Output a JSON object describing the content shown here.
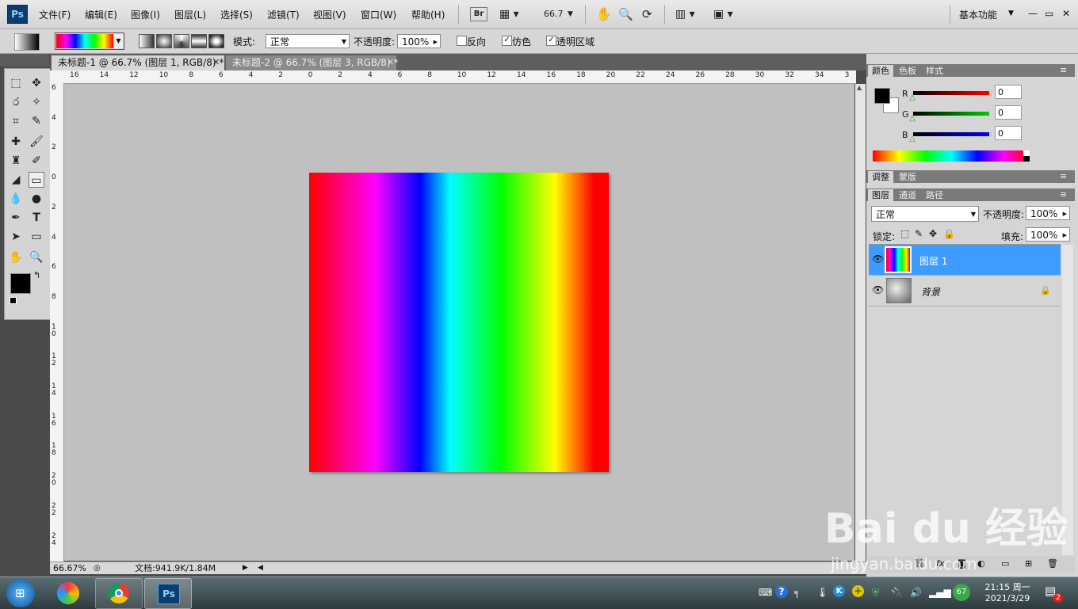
{
  "app": {
    "logo_text": "Ps"
  },
  "menubar": {
    "items": [
      "文件(F)",
      "编辑(E)",
      "图像(I)",
      "图层(L)",
      "选择(S)",
      "滤镜(T)",
      "视图(V)",
      "窗口(W)",
      "帮助(H)"
    ],
    "bridge_label": "Br",
    "zoom_value": "66.7",
    "workspace_label": "基本功能",
    "window_controls": [
      "—",
      "▭",
      "✕"
    ]
  },
  "options": {
    "mode_label": "模式:",
    "mode_value": "正常",
    "opacity_label": "不透明度:",
    "opacity_value": "100%",
    "reverse_label": "反向",
    "reverse_checked": false,
    "dither_label": "仿色",
    "dither_checked": true,
    "transparency_label": "透明区域",
    "transparency_checked": true
  },
  "tabs": [
    {
      "label": "未标题-1 @ 66.7% (图层 1, RGB/8) *",
      "active": true
    },
    {
      "label": "未标题-2 @ 66.7% (图层 3, RGB/8) *",
      "active": false
    }
  ],
  "ruler": {
    "top_labels": [
      "16",
      "14",
      "12",
      "10",
      "8",
      "6",
      "4",
      "2",
      "0",
      "2",
      "4",
      "6",
      "8",
      "10",
      "12",
      "14",
      "16",
      "18",
      "20",
      "22",
      "24",
      "26",
      "28",
      "30",
      "32",
      "34",
      "3"
    ],
    "left_labels": [
      "6",
      "4",
      "2",
      "0",
      "2",
      "4",
      "6",
      "8",
      "10",
      "12",
      "14",
      "16",
      "18",
      "20",
      "22",
      "24"
    ]
  },
  "status": {
    "zoom": "66.67%",
    "doc_info": "文档:941.9K/1.84M"
  },
  "color_panel": {
    "tabs": [
      "颜色",
      "色板",
      "样式"
    ],
    "channels": [
      {
        "name": "R",
        "value": "0",
        "color": "#c00000"
      },
      {
        "name": "G",
        "value": "0",
        "color": "#00a000"
      },
      {
        "name": "B",
        "value": "0",
        "color": "#0000c0"
      }
    ]
  },
  "adjust_panel": {
    "tabs": [
      "调整",
      "蒙版"
    ]
  },
  "layers_panel": {
    "tabs": [
      "图层",
      "通道",
      "路径"
    ],
    "blend_mode": "正常",
    "opacity_label": "不透明度:",
    "opacity_value": "100%",
    "lock_label": "锁定:",
    "fill_label": "填充:",
    "fill_value": "100%",
    "layers": [
      {
        "name": "图层 1",
        "selected": true,
        "locked": false
      },
      {
        "name": "背景",
        "selected": false,
        "locked": true
      }
    ]
  },
  "taskbar": {
    "apps": [
      "start-orb",
      "windows-explorer",
      "chrome",
      "photoshop"
    ],
    "ps_label": "Ps",
    "badge_value": "67",
    "time": "21:15 周一",
    "date": "2021/3/29",
    "notification_count": "2"
  },
  "watermark": {
    "text": "Bai du 经验",
    "url": "jingyan.baidu.com"
  },
  "colors": {
    "selected_layer": "#3e9bff",
    "foreground": "#000000",
    "background": "#ffffff"
  }
}
